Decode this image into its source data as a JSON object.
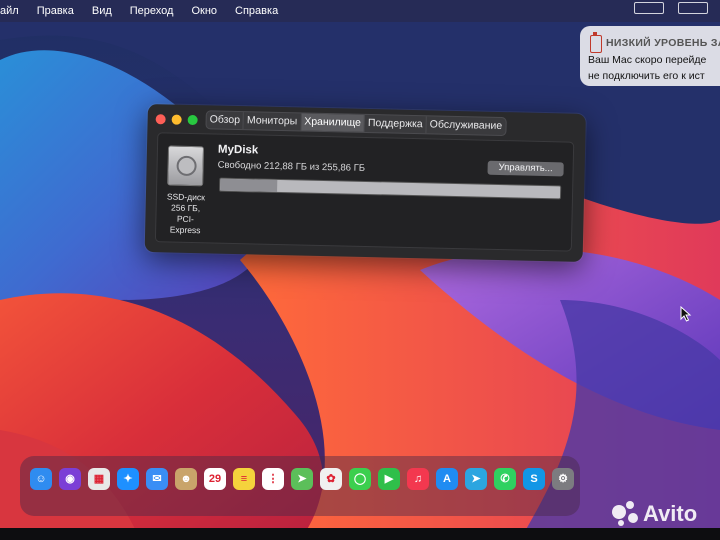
{
  "menubar": {
    "items": [
      "айл",
      "Правка",
      "Вид",
      "Переход",
      "Окно",
      "Справка"
    ]
  },
  "notification": {
    "title": "НИЗКИЙ УРОВЕНЬ ЗА",
    "line1": "Ваш Mac скоро перейде",
    "line2": "не подключить его к ист",
    "icon": "battery-low-icon"
  },
  "window": {
    "tabs": [
      {
        "label": "Обзор",
        "active": false
      },
      {
        "label": "Мониторы",
        "active": false
      },
      {
        "label": "Хранилище",
        "active": true
      },
      {
        "label": "Поддержка",
        "active": false
      },
      {
        "label": "Обслуживание",
        "active": false
      }
    ],
    "disk": {
      "name": "MyDisk",
      "free_text": "Свободно 212,88 ГБ из 255,86 ГБ",
      "caption_line1": "SSD-диск",
      "caption_line2": "256 ГБ,",
      "caption_line3": "PCI-Express",
      "manage_label": "Управлять...",
      "used_fraction": 0.168
    }
  },
  "dock": {
    "items": [
      {
        "name": "finder-icon",
        "color": "#2f8cf0",
        "glyph": "☺"
      },
      {
        "name": "siri-icon",
        "color": "#7b3fd6",
        "glyph": "◉"
      },
      {
        "name": "launchpad-icon",
        "color": "#e8e8e8",
        "glyph": "▦"
      },
      {
        "name": "safari-icon",
        "color": "#1e90ff",
        "glyph": "✦"
      },
      {
        "name": "mail-icon",
        "color": "#3a8ef5",
        "glyph": "✉"
      },
      {
        "name": "contacts-icon",
        "color": "#c9a46a",
        "glyph": "☻"
      },
      {
        "name": "calendar-icon",
        "color": "#ffffff",
        "glyph": "29"
      },
      {
        "name": "notes-icon",
        "color": "#f5d33c",
        "glyph": "≡"
      },
      {
        "name": "reminders-icon",
        "color": "#ffffff",
        "glyph": "⋮"
      },
      {
        "name": "maps-icon",
        "color": "#5cbf5a",
        "glyph": "➤"
      },
      {
        "name": "photos-icon",
        "color": "#f0f0f0",
        "glyph": "✿"
      },
      {
        "name": "messages-icon",
        "color": "#3ccf4e",
        "glyph": "◯"
      },
      {
        "name": "facetime-icon",
        "color": "#2fbf4a",
        "glyph": "▶"
      },
      {
        "name": "music-icon",
        "color": "#f3384f",
        "glyph": "♫"
      },
      {
        "name": "app-store-icon",
        "color": "#1f8cf2",
        "glyph": "A"
      },
      {
        "name": "telegram-icon",
        "color": "#2ca5e0",
        "glyph": "➤"
      },
      {
        "name": "whatsapp-icon",
        "color": "#2fd160",
        "glyph": "✆"
      },
      {
        "name": "skype-icon",
        "color": "#1296e6",
        "glyph": "S"
      },
      {
        "name": "system-preferences-icon",
        "color": "#7c7c80",
        "glyph": "⚙"
      }
    ]
  },
  "watermark": {
    "text": "Avito"
  },
  "colors": {
    "accent_close": "#fe5f57",
    "accent_minimize": "#febc2e",
    "accent_zoom": "#28c840"
  }
}
